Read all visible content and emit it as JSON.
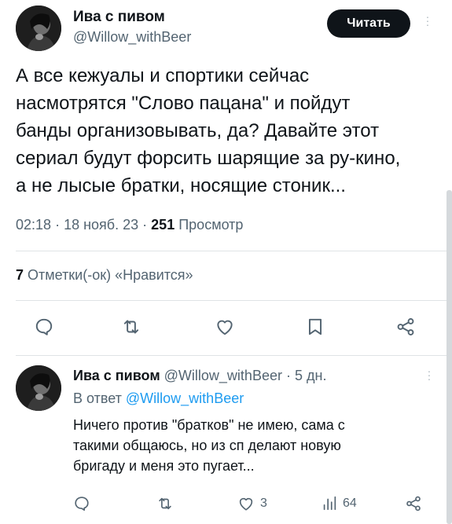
{
  "tweet": {
    "author_name": "Ива с пивом",
    "author_handle": "@Willow_withBeer",
    "follow_label": "Читать",
    "text": "А все кежуалы и спортики сейчас\nнасмотрятся \"Слово пацана\" и пойдут\nбанды организовывать, да? Давайте этот\nсериал будут форсить шарящие за ру-кино,\nа не лысые братки, носящие стоник...",
    "time": "02:18",
    "date": "18 нояб. 23",
    "separator": "·",
    "views_count": "251",
    "views_label": "Просмотр",
    "likes_count": "7",
    "likes_label": "Отметки(-ок) «Нравится»"
  },
  "reply": {
    "author_name": "Ива с пивом",
    "author_handle": "@Willow_withBeer",
    "age": "5 дн.",
    "separator": "·",
    "reply_to_label": "В ответ",
    "reply_to_handle": "@Willow_withBeer",
    "text": "Ничего против \"братков\" не имею, сама с\nтакими общаюсь, но из сп делают новую\nбригаду и меня это пугает...",
    "likes_count": "3",
    "views_count": "64"
  },
  "icons": [
    "reply-icon",
    "retweet-icon",
    "like-icon",
    "bookmark-icon",
    "share-icon",
    "views-icon",
    "more-icon"
  ],
  "colors": {
    "text": "#0f1419",
    "secondary": "#536471",
    "link": "#1d9bf0",
    "button": "#0f1419",
    "divider": "#dfe3e6"
  }
}
